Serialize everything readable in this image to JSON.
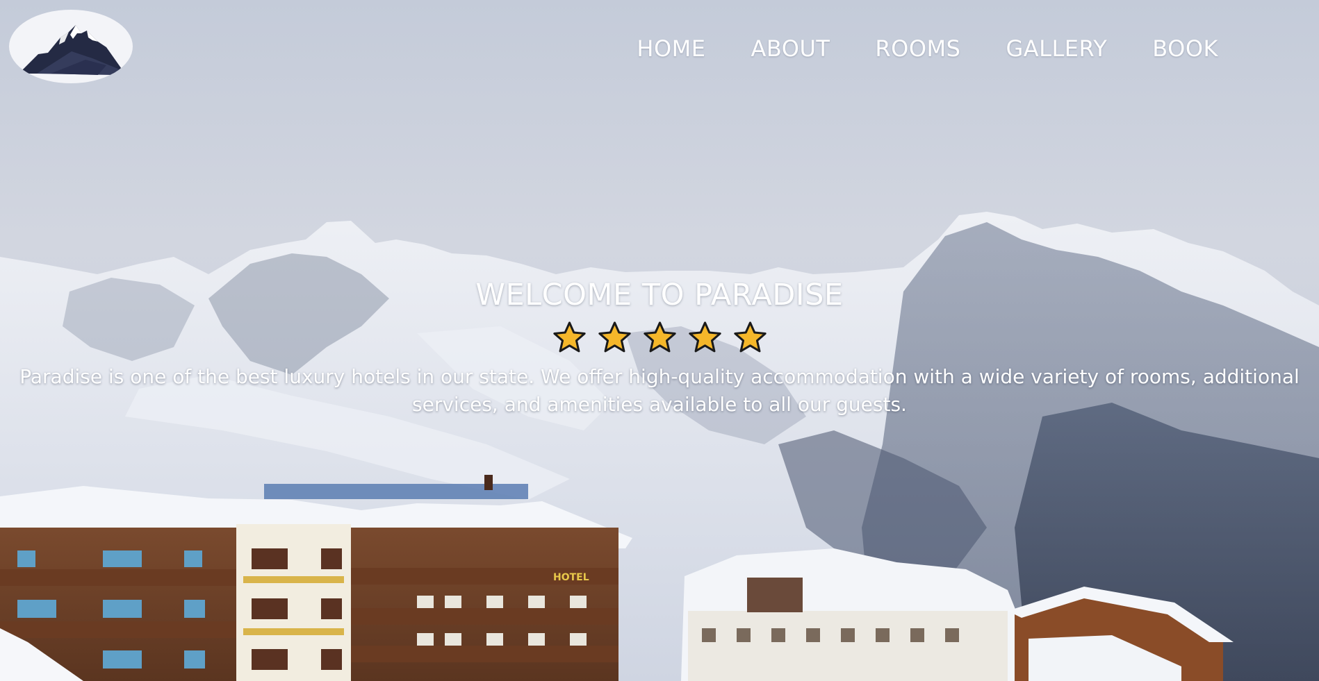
{
  "page": {
    "background_color": "#c8cfdd"
  },
  "logo": {
    "icon": "mountain-icon"
  },
  "nav": {
    "items": [
      {
        "label": "HOME"
      },
      {
        "label": "ABOUT"
      },
      {
        "label": "ROOMS"
      },
      {
        "label": "GALLERY"
      },
      {
        "label": "BOOK"
      }
    ]
  },
  "hero": {
    "title": "WELCOME TO PARADISE",
    "rating": {
      "stars": 5,
      "max": 5,
      "icon": "star-icon",
      "color": "#f5b72a"
    },
    "description": "Paradise is one of the best luxury hotels in our state. We offer high-quality accommodation with a wide variety of rooms, additional services, and amenities available to all our guests."
  },
  "background_image": {
    "hotel_sign": "HOTEL"
  }
}
